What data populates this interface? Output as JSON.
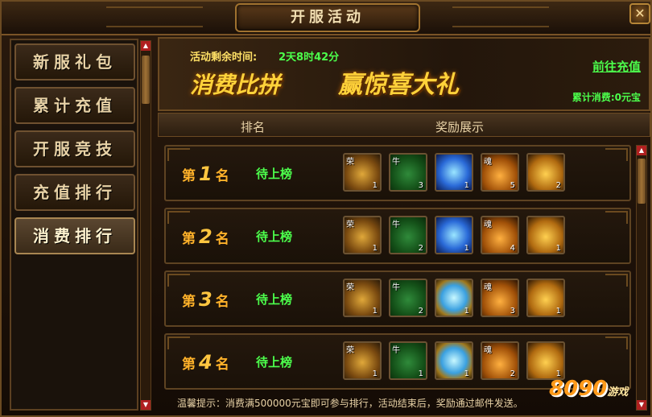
{
  "window": {
    "title": "开服活动",
    "close_label": "✕"
  },
  "sidebar": {
    "items": [
      {
        "label": "新服礼包",
        "active": false
      },
      {
        "label": "累计充值",
        "active": false
      },
      {
        "label": "开服竞技",
        "active": false
      },
      {
        "label": "充值排行",
        "active": false
      },
      {
        "label": "消费排行",
        "active": true
      }
    ]
  },
  "banner": {
    "time_label": "活动剩余时间:",
    "time_value": "2天8时42分",
    "title_left": "消费比拼",
    "title_right": "赢惊喜大礼",
    "recharge_link": "前往充值",
    "total_spend": "累计消费:0元宝"
  },
  "table": {
    "col_rank": "排名",
    "col_rewards": "奖励展示"
  },
  "ranks": [
    {
      "prefix": "第",
      "num": "1",
      "suffix": "名",
      "status": "待上榜",
      "items": [
        {
          "tag": "荣",
          "qty": "1",
          "icon": "golden-chest-icon"
        },
        {
          "tag": "牛",
          "qty": "3",
          "icon": "jade-chest-icon"
        },
        {
          "tag": "",
          "qty": "1",
          "icon": "blue-gem-icon"
        },
        {
          "tag": "魂",
          "qty": "5",
          "icon": "soul-bag-icon"
        },
        {
          "tag": "",
          "qty": "2",
          "icon": "golden-horn-icon"
        }
      ]
    },
    {
      "prefix": "第",
      "num": "2",
      "suffix": "名",
      "status": "待上榜",
      "items": [
        {
          "tag": "荣",
          "qty": "1",
          "icon": "golden-chest-icon"
        },
        {
          "tag": "牛",
          "qty": "2",
          "icon": "jade-chest-icon"
        },
        {
          "tag": "",
          "qty": "1",
          "icon": "blue-gem-icon"
        },
        {
          "tag": "魂",
          "qty": "4",
          "icon": "soul-bag-icon"
        },
        {
          "tag": "",
          "qty": "1",
          "icon": "golden-horn-icon"
        }
      ]
    },
    {
      "prefix": "第",
      "num": "3",
      "suffix": "名",
      "status": "待上榜",
      "items": [
        {
          "tag": "荣",
          "qty": "1",
          "icon": "golden-chest-icon"
        },
        {
          "tag": "牛",
          "qty": "2",
          "icon": "jade-chest-icon"
        },
        {
          "tag": "",
          "qty": "1",
          "icon": "blue-gem-icon"
        },
        {
          "tag": "魂",
          "qty": "3",
          "icon": "soul-bag-icon"
        },
        {
          "tag": "",
          "qty": "1",
          "icon": "golden-horn-icon"
        }
      ]
    },
    {
      "prefix": "第",
      "num": "4",
      "suffix": "名",
      "status": "待上榜",
      "items": [
        {
          "tag": "荣",
          "qty": "1",
          "icon": "golden-chest-icon"
        },
        {
          "tag": "牛",
          "qty": "1",
          "icon": "jade-chest-icon"
        },
        {
          "tag": "",
          "qty": "1",
          "icon": "blue-gem-icon"
        },
        {
          "tag": "魂",
          "qty": "2",
          "icon": "soul-bag-icon"
        },
        {
          "tag": "",
          "qty": "1",
          "icon": "golden-horn-icon"
        }
      ]
    }
  ],
  "footer": {
    "tip": "温馨提示：消费满500000元宝即可参与排行，活动结束后，奖励通过邮件发送。"
  },
  "watermark": {
    "logo": "8090",
    "sub": "游戏"
  }
}
